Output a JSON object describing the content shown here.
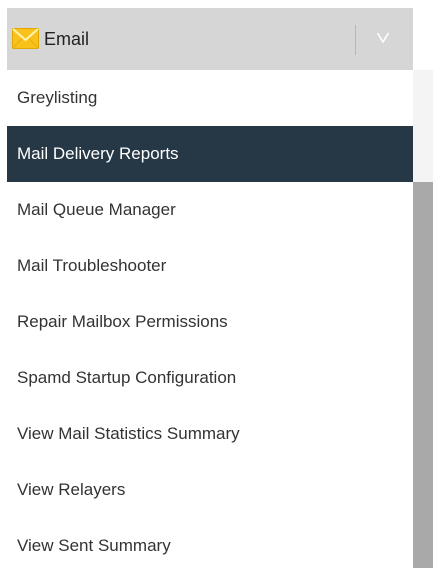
{
  "header": {
    "title": "Email",
    "icon": "envelope-icon",
    "toggle_icon": "chevron-down-icon"
  },
  "menu": {
    "active_index": 1,
    "items": [
      {
        "label": "Greylisting"
      },
      {
        "label": "Mail Delivery Reports"
      },
      {
        "label": "Mail Queue Manager"
      },
      {
        "label": "Mail Troubleshooter"
      },
      {
        "label": "Repair Mailbox Permissions"
      },
      {
        "label": "Spamd Startup Configuration"
      },
      {
        "label": "View Mail Statistics Summary"
      },
      {
        "label": "View Relayers"
      },
      {
        "label": "View Sent Summary"
      }
    ]
  },
  "colors": {
    "header_bg": "#d6d6d6",
    "active_bg": "#263746",
    "active_text": "#ffffff",
    "item_text": "#333333",
    "scrollbar_thumb": "#a9a9a9",
    "envelope_yellow": "#f9c21b"
  }
}
